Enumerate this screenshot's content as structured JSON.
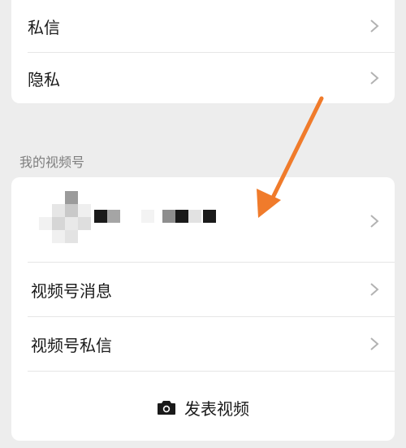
{
  "top_card": {
    "items": [
      {
        "label": "私信"
      },
      {
        "label": "隐私"
      }
    ]
  },
  "channels_section": {
    "header": "我的视频号",
    "items": [
      {
        "label": "视频号消息"
      },
      {
        "label": "视频号私信"
      }
    ],
    "publish_label": "发表视频"
  },
  "colors": {
    "background": "#ededed",
    "card": "#ffffff",
    "annotation_arrow": "#f07b2b",
    "text": "#1a1a1a",
    "muted": "#7f7f7f"
  },
  "icons": {
    "chevron": "chevron-right-icon",
    "camera": "camera-icon",
    "annotation": "annotation-arrow-icon"
  }
}
